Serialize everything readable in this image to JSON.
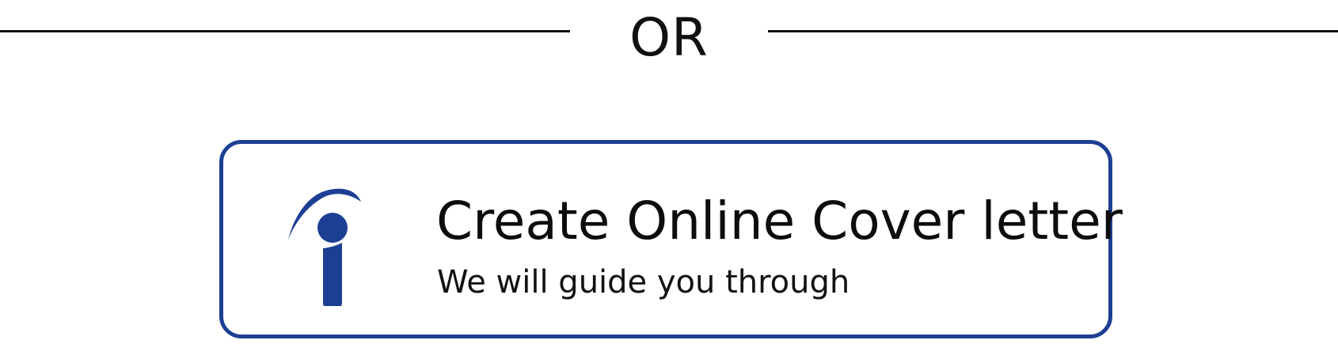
{
  "divider": {
    "text": "OR"
  },
  "card": {
    "title": "Create Online Cover letter",
    "subtitle": "We will guide you through",
    "icon": "indeed-logo-icon"
  },
  "colors": {
    "accent": "#1d3f93",
    "text": "#111111",
    "background": "#ffffff"
  }
}
